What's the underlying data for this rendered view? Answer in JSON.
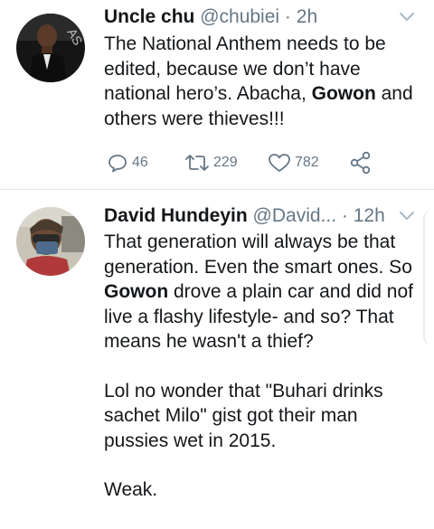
{
  "tweets": [
    {
      "display_name": "Uncle chu",
      "handle": "@chubiei",
      "separator": "·",
      "time": "2h",
      "text_parts": [
        "The National Anthem needs to be edited, because we don’t have national hero’s. Abacha, ",
        "Gowon",
        " and others were thieves!!!"
      ],
      "actions": {
        "replies": "46",
        "retweets": "229",
        "likes": "782"
      }
    },
    {
      "display_name": "David Hundeyin",
      "handle": "@David...",
      "separator": "·",
      "time": "12h",
      "text_parts": [
        "That generation will always be that generation. Even the smart ones. So ",
        "Gowon",
        " drove a plain car and did nof live a flashy lifestyle- and so? That means he wasn't a thief?"
      ],
      "paragraph2": "Lol no wonder that \"Buhari drinks sachet Milo\" gist got their man pussies wet in 2015.",
      "paragraph3": "Weak."
    }
  ],
  "icons": {
    "more": "chevron-down-icon",
    "reply": "reply-icon",
    "retweet": "retweet-icon",
    "like": "heart-icon",
    "share": "share-icon"
  },
  "colors": {
    "text": "#14171a",
    "secondary": "#657786",
    "divider": "#e1e8ed"
  }
}
